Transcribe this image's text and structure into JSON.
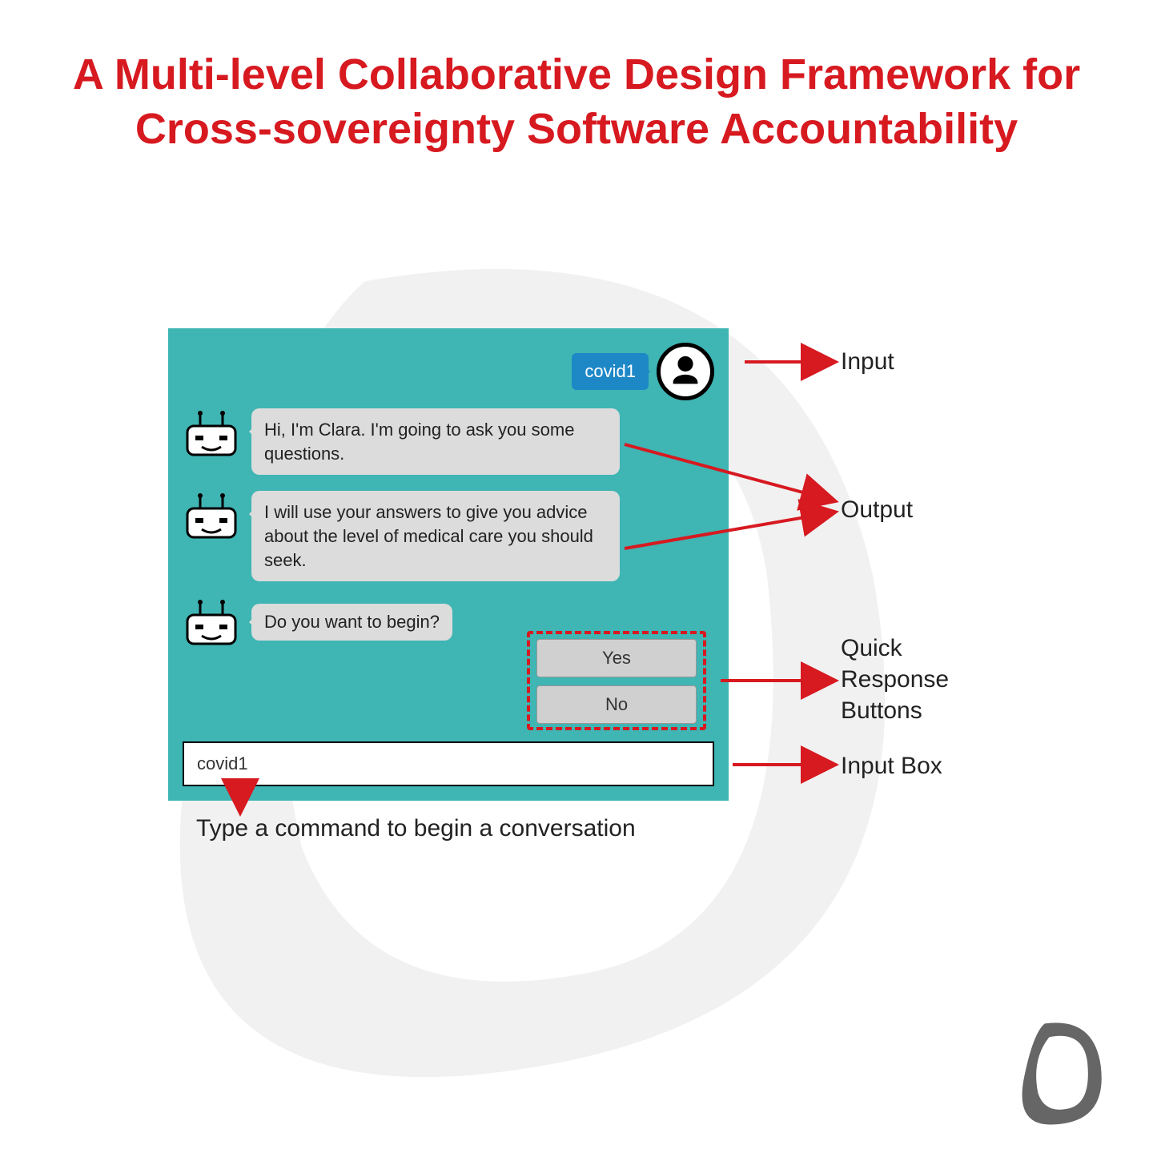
{
  "title": "A Multi-level Collaborative Design Framework for Cross-sovereignty Software Accountability",
  "chat": {
    "user_input": "covid1",
    "bot_messages": [
      "Hi, I'm Clara. I'm going to ask you some questions.",
      "I will use your answers to give you advice about the level of medical care you should seek.",
      "Do you want to begin?"
    ],
    "quick_responses": [
      "Yes",
      "No"
    ],
    "input_value": "covid1"
  },
  "annotations": {
    "input": "Input",
    "output": "Output",
    "quick_response": "Quick\nResponse\nButtons",
    "input_box": "Input Box",
    "caption": "Type a command to begin a conversation"
  },
  "colors": {
    "accent_red": "#d71920",
    "chat_teal": "#3fb5b4",
    "user_blue": "#1e88c7"
  }
}
